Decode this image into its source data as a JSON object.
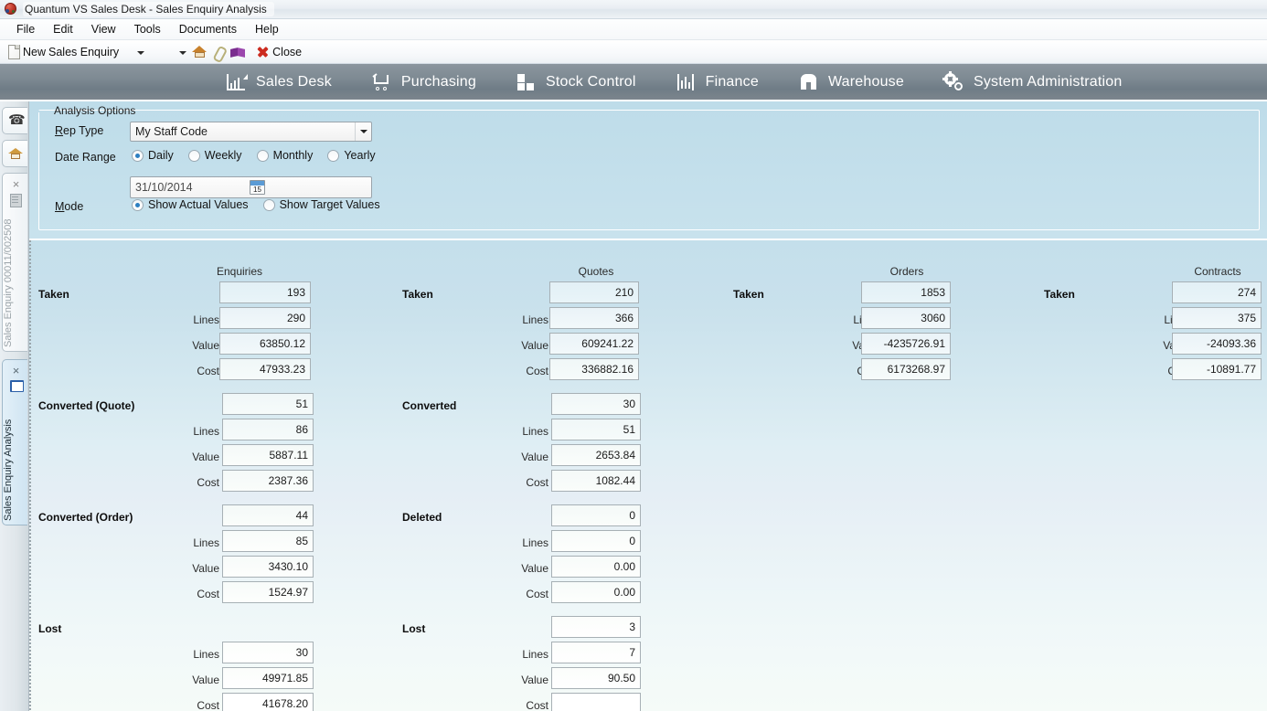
{
  "window": {
    "title": "Quantum VS Sales Desk -  Sales Enquiry Analysis",
    "app_icon": "quantum-logo-icon"
  },
  "menu": {
    "items": [
      "File",
      "Edit",
      "View",
      "Tools",
      "Documents",
      "Help"
    ]
  },
  "toolbar": {
    "new_label": "New",
    "new_doc_label": "Sales Enquiry",
    "close_label": "Close",
    "icons": [
      "page-icon",
      "chevron-down-icon",
      "magnifier-icon",
      "home-icon",
      "paperclip-icon",
      "book-icon",
      "red-x-icon"
    ]
  },
  "nav": {
    "items": [
      {
        "label": "Sales Desk",
        "icon": "sales-chart-icon"
      },
      {
        "label": "Purchasing",
        "icon": "shopping-trolley-icon"
      },
      {
        "label": "Stock Control",
        "icon": "blocks-icon"
      },
      {
        "label": "Finance",
        "icon": "bar-chart-icon"
      },
      {
        "label": "Warehouse",
        "icon": "warehouse-building-icon"
      },
      {
        "label": "System Administration",
        "icon": "gears-icon"
      }
    ]
  },
  "sidebar": {
    "buttons": [
      {
        "icon": "phone-icon"
      },
      {
        "icon": "home-icon"
      }
    ],
    "tabs": [
      {
        "label": "Sales Enquiry 00011/002508",
        "icon": "document-icon",
        "active": false,
        "close": "×"
      },
      {
        "label": "Sales Enquiry Analysis",
        "icon": "book-icon",
        "active": true,
        "close": "×"
      }
    ]
  },
  "options": {
    "legend": "Analysis Options",
    "rep_type_label": "Rep Type",
    "rep_type_value": "My Staff Code",
    "date_range_label": "Date Range",
    "date_range_options": [
      {
        "label": "Daily",
        "selected": true
      },
      {
        "label": "Weekly",
        "selected": false
      },
      {
        "label": "Monthly",
        "selected": false
      },
      {
        "label": "Yearly",
        "selected": false
      }
    ],
    "date_value": "31/10/2014",
    "calendar_day": "15",
    "mode_label": "Mode",
    "mode_options": [
      {
        "label": "Show Actual Values",
        "selected": true
      },
      {
        "label": "Show Target Values",
        "selected": false
      }
    ]
  },
  "table": {
    "sub_labels": [
      "Lines",
      "Value",
      "Cost"
    ],
    "columns": [
      {
        "header": "Enquiries",
        "groups": [
          {
            "title": "Taken",
            "value": "193",
            "lines": "290",
            "val": "63850.12",
            "cost": "47933.23"
          },
          {
            "title": "Converted (Quote)",
            "value": "51",
            "lines": "86",
            "val": "5887.11",
            "cost": "2387.36"
          },
          {
            "title": "Converted (Order)",
            "value": "44",
            "lines": "85",
            "val": "3430.10",
            "cost": "1524.97"
          },
          {
            "title": "Lost",
            "value": "",
            "lines": "30",
            "val": "49971.85",
            "cost": "41678.20"
          }
        ]
      },
      {
        "header": "Quotes",
        "groups": [
          {
            "title": "Taken",
            "value": "210",
            "lines": "366",
            "val": "609241.22",
            "cost": "336882.16"
          },
          {
            "title": "Converted",
            "value": "30",
            "lines": "51",
            "val": "2653.84",
            "cost": "1082.44"
          },
          {
            "title": "Deleted",
            "value": "0",
            "lines": "0",
            "val": "0.00",
            "cost": "0.00"
          },
          {
            "title": "Lost",
            "value": "3",
            "lines": "7",
            "val": "90.50",
            "cost": ""
          }
        ]
      },
      {
        "header": "Orders",
        "groups": [
          {
            "title": "Taken",
            "value": "1853",
            "lines": "3060",
            "val": "-4235726.91",
            "cost": "6173268.97"
          }
        ]
      },
      {
        "header": "Contracts",
        "groups": [
          {
            "title": "Taken",
            "value": "274",
            "lines": "375",
            "val": "-24093.36",
            "cost": "-10891.77"
          }
        ]
      }
    ]
  },
  "colors": {
    "nav_bar": "#7b858d",
    "content_bg": "#bcdbe8",
    "radio_dot": "#2d7fc1",
    "close_x": "#cc2b1f"
  }
}
